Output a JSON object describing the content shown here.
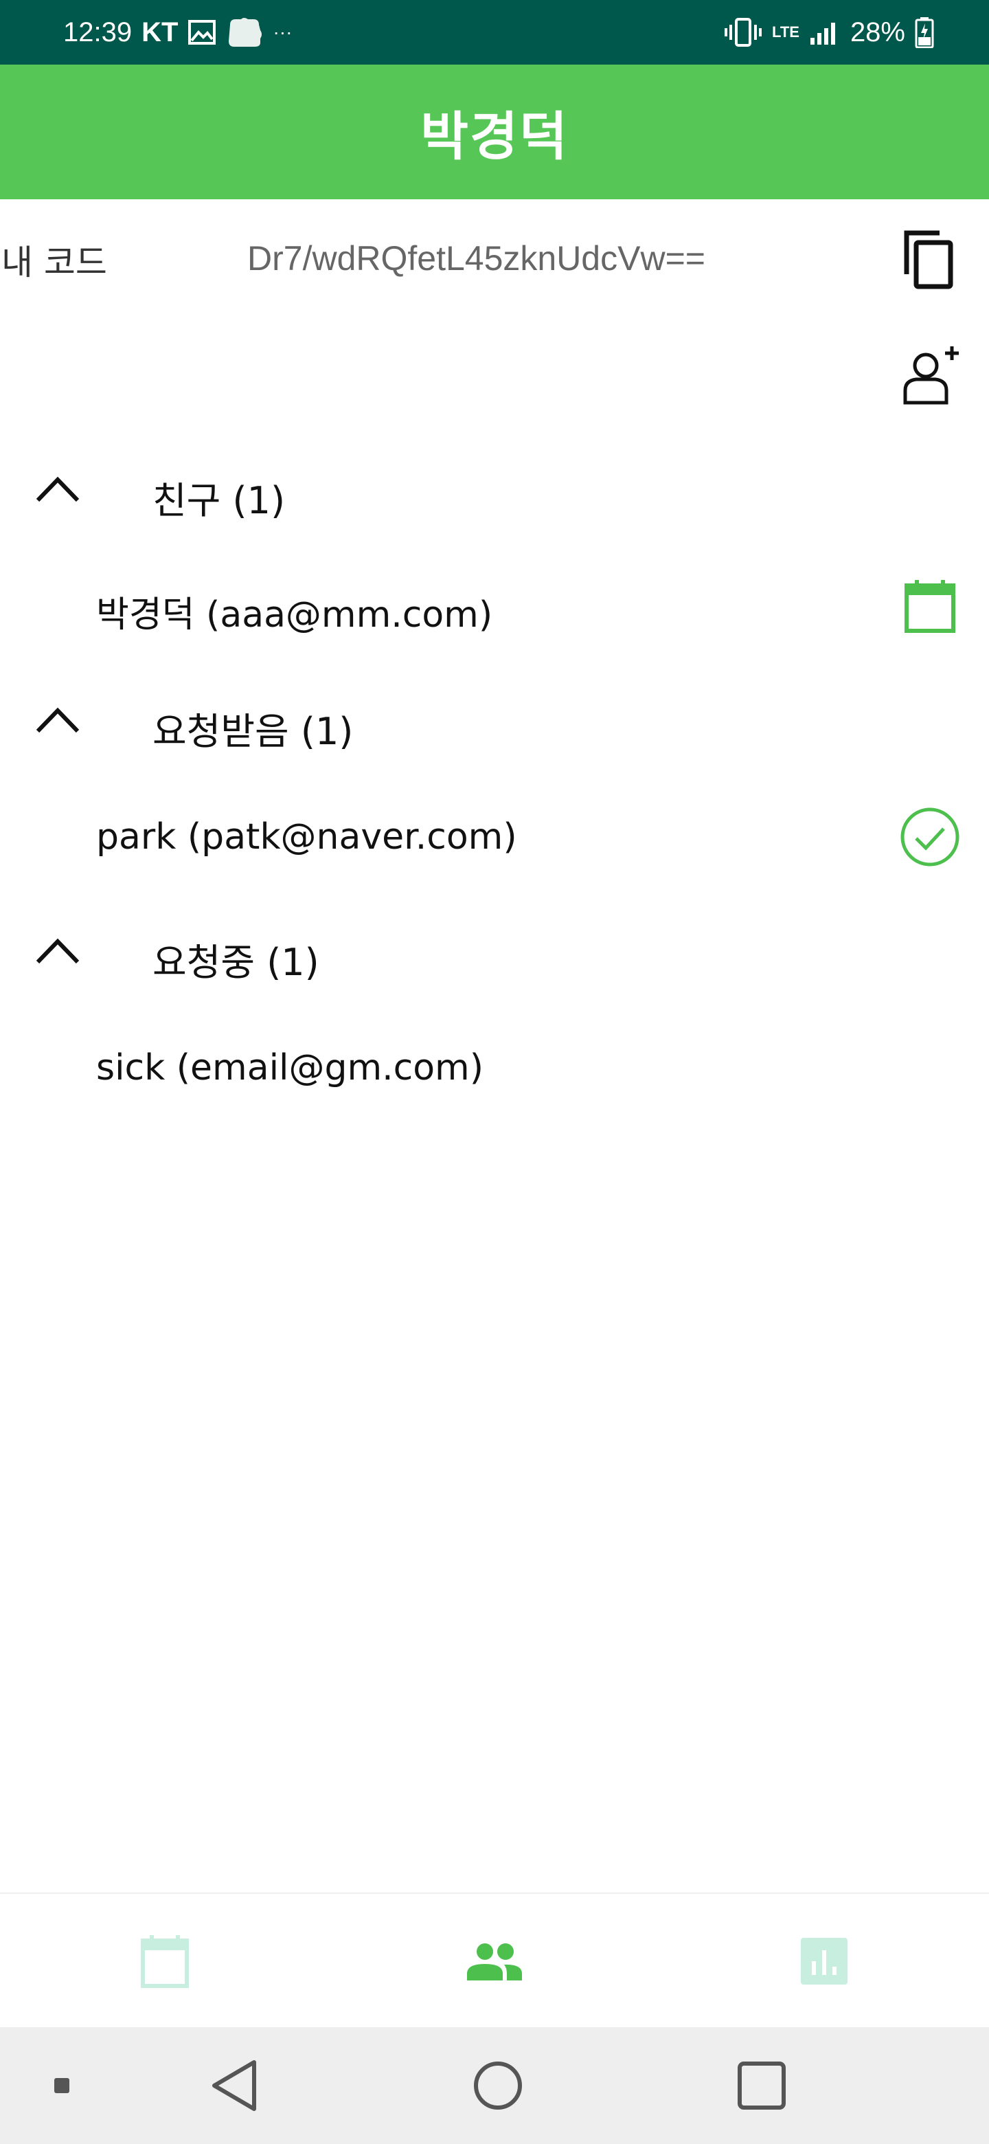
{
  "status_bar": {
    "time": "12:39",
    "carrier": "KT",
    "more": "···",
    "network": "LTE",
    "battery": "28%"
  },
  "app_bar": {
    "title": "박경덕"
  },
  "code_row": {
    "label": "내 코드",
    "value": "Dr7/wdRQfetL45zknUdcVw=="
  },
  "sections": [
    {
      "title": "친구 (1)",
      "item": "박경덕 (aaa@mm.com)",
      "action_icon": "calendar-icon"
    },
    {
      "title": "요청받음 (1)",
      "item": "park (patk@naver.com)",
      "action_icon": "check-circle-icon"
    },
    {
      "title": "요청중 (1)",
      "item": "sick (email@gm.com)",
      "action_icon": ""
    }
  ],
  "bottom_nav": {
    "items": [
      "calendar-icon",
      "people-icon",
      "chart-icon"
    ],
    "active_index": 1
  },
  "colors": {
    "status_bar": "#00574b",
    "app_bar": "#56c756",
    "accent": "#4cbf4c",
    "inactive_nav": "#c7eede",
    "system_nav": "#eeeeee"
  }
}
